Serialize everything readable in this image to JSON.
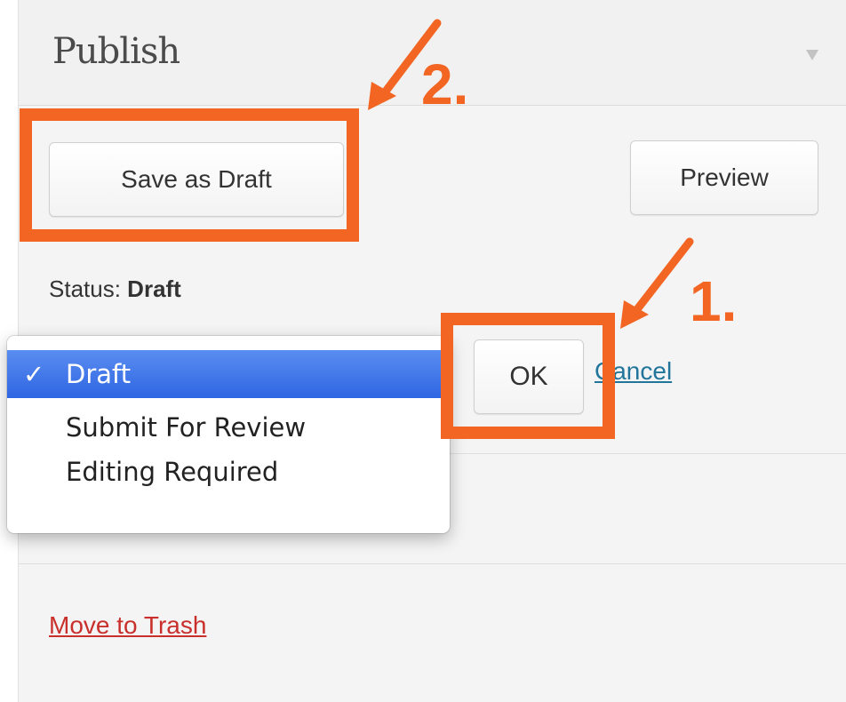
{
  "panel": {
    "title": "Publish",
    "toggle_icon": "triangle-down-icon"
  },
  "buttons": {
    "save_draft": "Save as Draft",
    "preview": "Preview",
    "ok": "OK",
    "cancel": "Cancel"
  },
  "status": {
    "label": "Status:",
    "value": "Draft"
  },
  "status_dropdown": {
    "options": [
      {
        "label": "Draft",
        "selected": true,
        "check": "✓"
      },
      {
        "label": "Submit For Review",
        "selected": false
      },
      {
        "label": "Editing Required",
        "selected": false
      }
    ]
  },
  "actions": {
    "trash": "Move to Trash"
  },
  "annotations": {
    "step1": "1.",
    "step2": "2.",
    "color": "#f26522"
  }
}
